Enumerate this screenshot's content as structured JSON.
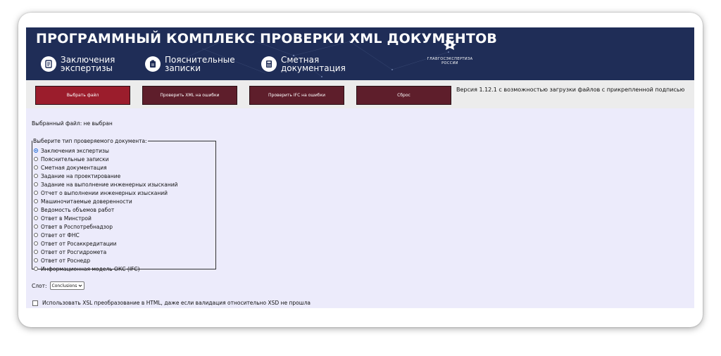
{
  "header": {
    "title": "ПРОГРАММНЫЙ КОМПЛЕКС ПРОВЕРКИ XML ДОКУМЕНТОВ",
    "nav": [
      {
        "label": "Заключения\nэкспертизы",
        "icon": "document-icon"
      },
      {
        "label": "Пояснительные\nзаписки",
        "icon": "notes-icon"
      },
      {
        "label": "Сметная\nдокументация",
        "icon": "calculator-icon"
      }
    ],
    "emblem_text": "ГЛАВГОСЭКСПЕРТИЗА\nРОССИИ"
  },
  "toolbar": {
    "choose_file": "Выбрать файл",
    "check_xml": "Проверить XML на ошибки",
    "check_ifc": "Проверить IFC на ошибки",
    "reset": "Сброс",
    "version": "Версия 1.12.1 с возможностью загрузки файлов с прикрепленной подписью"
  },
  "selected_file": "Выбранный файл:  не выбран",
  "doc_types": {
    "legend": "Выберите тип проверяемого документа:",
    "selected_index": 0,
    "options": [
      "Заключения экспертизы",
      "Пояснительные записки",
      "Сметная документация",
      "Задание на проектирование",
      "Задание на выполнение инженерных изысканий",
      "Отчет о выполнении инженерных изысканий",
      "Машиночитаемые доверенности",
      "Ведомость объемов работ",
      "Ответ в Минстрой",
      "Ответ в Роспотребнадзор",
      "Ответ от ФНС",
      "Ответ от Росаккредитации",
      "Ответ от Росгидромета",
      "Ответ от Роснедр",
      "Информационная модель ОКС (IFC)"
    ]
  },
  "slot": {
    "label": "Слот:",
    "selected": "Conclusions"
  },
  "xsl_checkbox": {
    "label": "Использовать XSL преобразование в HTML, даже если валидация относительно XSD не прошла",
    "checked": false
  },
  "colors": {
    "header_bg": "#1f2d57",
    "primary_button": "#9b1d2c",
    "dark_button": "#5e1e2b",
    "page_bg": "#ecebfb"
  }
}
